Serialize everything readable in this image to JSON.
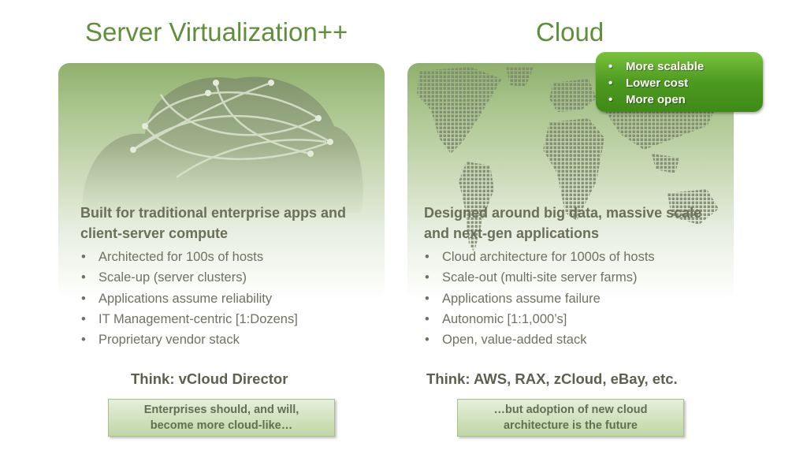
{
  "left": {
    "title": "Server Virtualization++",
    "heading": "Built for traditional enterprise apps and client-server compute",
    "bullets": [
      "Architected for 100s of hosts",
      "Scale-up (server clusters)",
      "Applications assume reliability",
      "IT Management-centric [1:Dozens]",
      "Proprietary vendor stack"
    ],
    "think": "Think: vCloud Director",
    "note": "Enterprises should, and will, become more cloud-like…",
    "icon": "cloud-network-icon"
  },
  "right": {
    "title": "Cloud",
    "heading": "Designed around big data, massive scale and next-gen applications",
    "bullets": [
      "Cloud architecture for 1000s of hosts",
      "Scale-out (multi-site server farms)",
      "Applications assume failure",
      "Autonomic [1:1,000’s]",
      "Open, value-added stack"
    ],
    "think": "Think: AWS, RAX, zCloud, eBay, etc.",
    "note": "…but adoption of new cloud architecture is the future",
    "icon": "dotted-world-map-icon",
    "badge": [
      "More scalable",
      "Lower cost",
      "More open"
    ]
  },
  "colors": {
    "title": "#5f8f3a",
    "text": "#6e7263",
    "badge": "#4d9a20"
  }
}
